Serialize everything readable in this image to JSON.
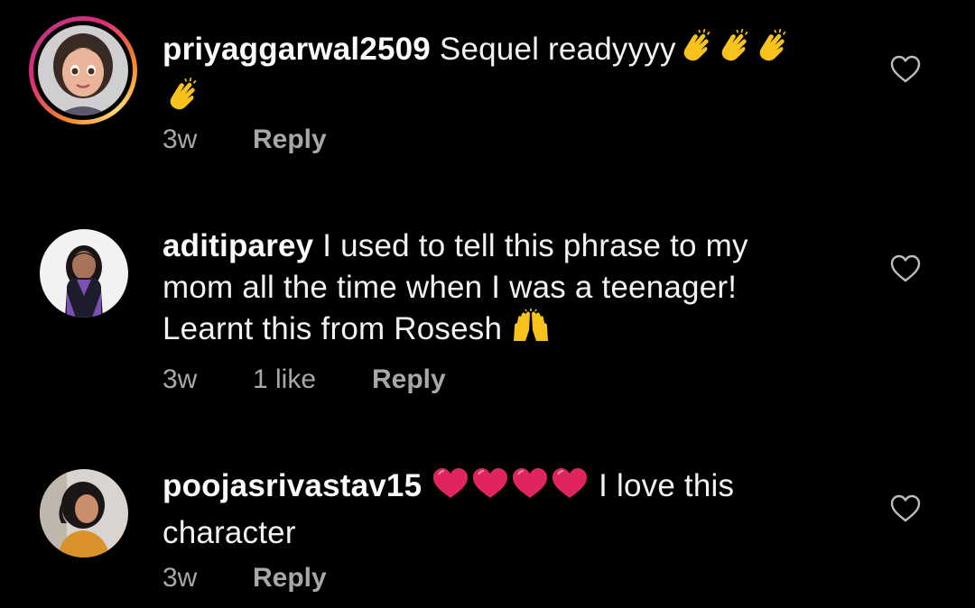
{
  "comments": [
    {
      "username": "priyaggarwal2509",
      "text": "Sequel readyyyy",
      "emojis": [
        "clapping-hands",
        "clapping-hands",
        "clapping-hands",
        "clapping-hands"
      ],
      "time": "3w",
      "likes": "",
      "reply_label": "Reply",
      "has_story_ring": true
    },
    {
      "username": "aditiparey",
      "text_line1": "I used to tell this phrase to my",
      "text_line2": "mom all the time when I was a teenager!",
      "text_line3": "Learnt this from Rosesh",
      "emojis": [
        "raising-hands"
      ],
      "time": "3w",
      "likes": "1 like",
      "reply_label": "Reply",
      "has_story_ring": false
    },
    {
      "username": "poojasrivastav15",
      "emojis": [
        "red-heart",
        "red-heart",
        "red-heart",
        "red-heart"
      ],
      "text_line1": "I love this",
      "text_line2": "character",
      "time": "3w",
      "likes": "",
      "reply_label": "Reply",
      "has_story_ring": false
    }
  ],
  "colors": {
    "background": "#000000",
    "text": "#f5f5f5",
    "meta": "#a8a8a8",
    "heart_emoji": "#e0245e",
    "clap_emoji": "#f7c21c"
  }
}
